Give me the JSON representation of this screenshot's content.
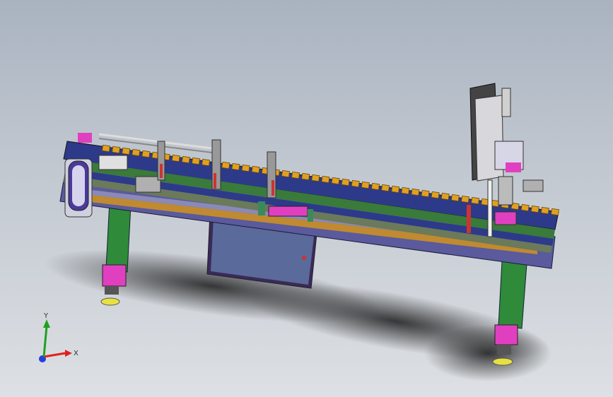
{
  "viewport": {
    "background_top": "#a9b3c0",
    "background_bottom": "#dde0e4"
  },
  "model": {
    "frame_color": "#5a5a9c",
    "rail_color": "#2d3a8a",
    "chain_color": "#e0a020",
    "leg_color": "#2f8a3a",
    "accent_color": "#e040c0",
    "foot_color": "#e8e040",
    "panel_color": "#5a6a9a"
  },
  "triad": {
    "x_label": "X",
    "y_label": "Y",
    "x_color": "#e02020",
    "y_color": "#20a020",
    "z_color": "#2040e0"
  }
}
